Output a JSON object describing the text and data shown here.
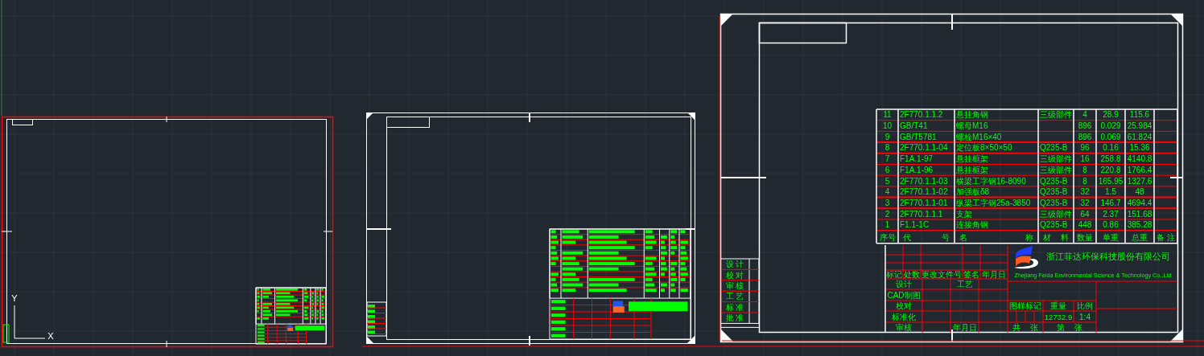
{
  "axis_labels": [
    "Y",
    "X"
  ],
  "parts_list": {
    "rows": [
      [
        "11",
        "2F770.1.1.2",
        "悬挂角钢",
        "三级部件",
        "4",
        "28.9",
        "115.6"
      ],
      [
        "10",
        "GB/T41",
        "螺母M16",
        "",
        "896",
        "0.029",
        "25.984"
      ],
      [
        "9",
        "GB/T5781",
        "螺栓M16×40",
        "",
        "896",
        "0.069",
        "61.824"
      ],
      [
        "8",
        "2F770.1.1-04",
        "定位板8×50×50",
        "Q235-B",
        "96",
        "0.16",
        "15.36"
      ],
      [
        "7",
        "F1A.1-97",
        "悬挂框架",
        "三级部件",
        "16",
        "258.8",
        "4140.8"
      ],
      [
        "6",
        "F1A.1-96",
        "悬挂框架",
        "三级部件",
        "8",
        "220.8",
        "1766.4"
      ],
      [
        "5",
        "2F770.1.1-03",
        "横梁工字钢16-8090",
        "Q235-B",
        "8",
        "165.95",
        "1327.6"
      ],
      [
        "4",
        "2F770.1.1-02",
        "加强板δ8",
        "Q235-B",
        "32",
        "1.5",
        "48"
      ],
      [
        "3",
        "2F770.1.1-01",
        "纵梁工字钢25a-3850",
        "Q235-B",
        "32",
        "146.7",
        "4694.4"
      ],
      [
        "2",
        "2F770.1.1.1",
        "支架",
        "三级部件",
        "64",
        "2.37",
        "151.68"
      ],
      [
        "1",
        "F1.1-1C",
        "连接角钢",
        "Q235-B",
        "448",
        "0.86",
        "385.28"
      ]
    ],
    "footer_row": [
      "序号",
      "代 号",
      "名 称",
      "材 料",
      "数量",
      "单重",
      "总重",
      "备 注"
    ]
  },
  "approval_stack": [
    "设 计",
    "校 对",
    "审 核",
    "工 艺",
    "标 准",
    "批 准"
  ],
  "title_block": {
    "company": "浙江菲达环保科技股份有限公司",
    "company_en": "Zhejiang Feida Environmental Science & Technology Co.,Ltd",
    "revision_labels": [
      "标记",
      "处数",
      "更改文件号",
      "签名",
      "年月日"
    ],
    "fields": [
      "设计",
      "工艺",
      "CAD制图",
      "校对",
      "标准化",
      "审核",
      "年月日",
      "图样标记",
      "重量",
      "比例",
      "12732.9",
      "1:4",
      "共 张",
      "第 张"
    ]
  }
}
